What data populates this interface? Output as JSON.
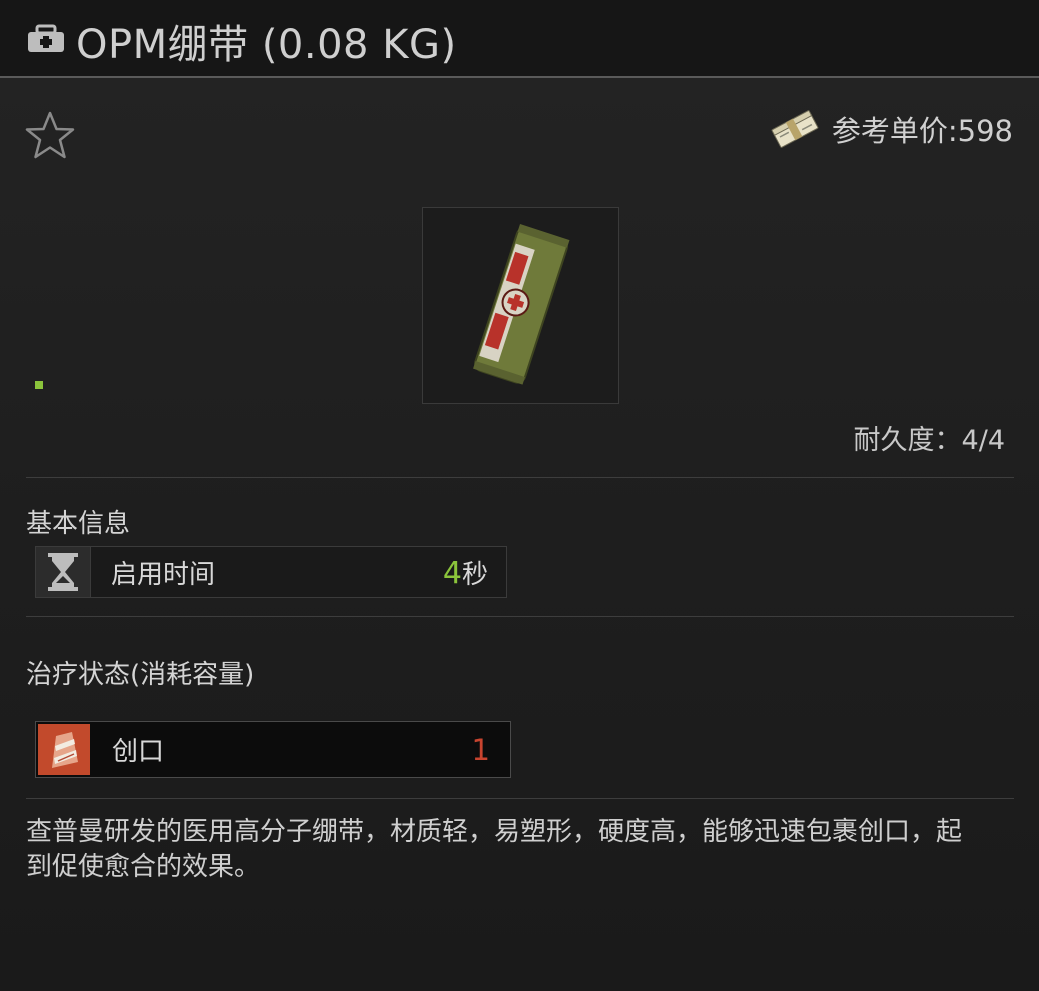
{
  "header": {
    "icon": "medkit-icon",
    "title": "OPM绷带 (0.08 KG)"
  },
  "item": {
    "favorite_icon": "star-outline-icon",
    "price_icon": "cash-stack-icon",
    "price_label": "参考单价:598",
    "image_icon": "bandage-item-icon",
    "durability_label": "耐久度：4/4"
  },
  "basic_info": {
    "title": "基本信息",
    "rows": [
      {
        "icon": "hourglass-icon",
        "label": "启用时间",
        "value_number": "4",
        "value_unit": "秒"
      }
    ]
  },
  "treatment": {
    "title": "治疗状态(消耗容量)",
    "rows": [
      {
        "icon": "wound-bandage-icon",
        "label": "创口",
        "value": "1"
      }
    ]
  },
  "description": "查普曼研发的医用高分子绷带，材质轻，易塑形，硬度高，能够迅速包裹创口，起到促使愈合的效果。",
  "colors": {
    "accent_green": "#8bc43b",
    "accent_red": "#c8442f",
    "background": "#1c1c1c"
  }
}
